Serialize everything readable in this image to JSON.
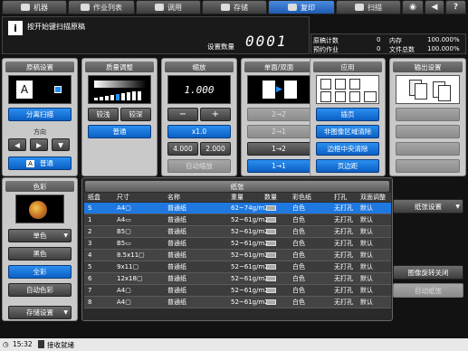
{
  "tabs": [
    {
      "label": "机器",
      "icon": "machine-icon"
    },
    {
      "label": "作业列表",
      "icon": "job-list-icon"
    },
    {
      "label": "调用",
      "icon": "recall-icon"
    },
    {
      "label": "存储",
      "icon": "store-icon"
    },
    {
      "label": "复印",
      "icon": "copy-icon"
    },
    {
      "label": "扫描",
      "icon": "scan-icon"
    }
  ],
  "status": {
    "message": "按开始键扫描原稿",
    "qty_label": "设置数量",
    "qty_value": "0001"
  },
  "counters": [
    {
      "label": "原稿计数",
      "value": "0",
      "label2": "内存",
      "value2": "100.000%"
    },
    {
      "label": "预约作业",
      "value": "0",
      "label2": "文件总数",
      "value2": "100.000%"
    }
  ],
  "original": {
    "title": "原稿设置",
    "separate_scan": "分离扫描",
    "direction_label": "方向",
    "normal": "普通"
  },
  "quality": {
    "title": "质量调整",
    "lighter": "较浅",
    "darker": "较深",
    "normal": "普通"
  },
  "zoom": {
    "title": "缩放",
    "value": "1.000",
    "minus": "−",
    "plus": "+",
    "x1": "x1.0",
    "p1": "4.000",
    "p2": "2.000",
    "auto": "自动缩放"
  },
  "duplex": {
    "title": "单面/双面",
    "b1": "2→2",
    "b2": "2→1",
    "b3": "1→2",
    "b4": "1→1"
  },
  "application": {
    "title": "应用",
    "b1": "插页",
    "b2": "非图像区域清除",
    "b3": "边框中央清除",
    "b4": "页边距"
  },
  "output": {
    "title": "输出设置"
  },
  "color": {
    "title": "色彩",
    "b1": "单色",
    "b2": "黑色",
    "b3": "全彩",
    "b4": "自动色彩",
    "store": "存储设置"
  },
  "paper": {
    "title": "纸张",
    "headers": [
      "纸盒",
      "尺寸",
      "名称",
      "重量",
      "数量",
      "彩色纸",
      "打孔",
      "双面调整"
    ],
    "rows": [
      [
        "S",
        "A4▢",
        "普通纸",
        "62~74g/m2",
        "白色",
        "无打孔",
        "默认"
      ],
      [
        "1",
        "A4▭",
        "普通纸",
        "52~61g/m2",
        "白色",
        "无打孔",
        "默认"
      ],
      [
        "2",
        "B5▢",
        "普通纸",
        "52~61g/m2",
        "白色",
        "无打孔",
        "默认"
      ],
      [
        "3",
        "B5▭",
        "普通纸",
        "52~61g/m2",
        "白色",
        "无打孔",
        "默认"
      ],
      [
        "4",
        "8.5x11▢",
        "普通纸",
        "52~61g/m2",
        "白色",
        "无打孔",
        "默认"
      ],
      [
        "5",
        "9x11▢",
        "普通纸",
        "52~61g/m2",
        "白色",
        "无打孔",
        "默认"
      ],
      [
        "6",
        "12x18▢",
        "普通纸",
        "52~61g/m2",
        "白色",
        "无打孔",
        "默认"
      ],
      [
        "7",
        "A4▢",
        "普通纸",
        "52~61g/m2",
        "白色",
        "无打孔",
        "默认"
      ],
      [
        "8",
        "A4▢",
        "普通纸",
        "52~61g/m2",
        "白色",
        "无打孔",
        "默认"
      ]
    ],
    "settings_btn": "纸张设置",
    "rotate_off": "图像旋转关闭",
    "auto_paper": "自动纸张"
  },
  "footer": {
    "time": "15:32",
    "status": "接收就绪"
  }
}
